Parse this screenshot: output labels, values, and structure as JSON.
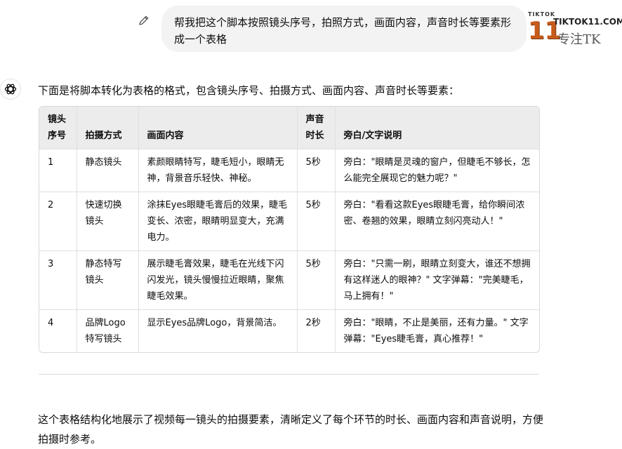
{
  "user_message": {
    "text": "帮我把这个脚本按照镜头序号，拍照方式，画面内容，声音时长等要素形成一个表格"
  },
  "watermark": {
    "top": "TIKTOK",
    "number": "11",
    "site": "TIKTOK11.COM",
    "slogan": "专注TK"
  },
  "assistant": {
    "intro": "下面是将脚本转化为表格的格式，包含镜头序号、拍摄方式、画面内容、声音时长等要素：",
    "table": {
      "headers": [
        "镜头序号",
        "拍摄方式",
        "画面内容",
        "声音时长",
        "旁白/文字说明"
      ],
      "rows": [
        [
          "1",
          "静态镜头",
          "素颜眼睛特写，睫毛短小，眼睛无神，背景音乐轻快、神秘。",
          "5秒",
          "旁白：\"眼睛是灵魂的窗户，但睫毛不够长，怎么能完全展现它的魅力呢？\""
        ],
        [
          "2",
          "快速切换镜头",
          "涂抹Eyes眼睫毛膏后的效果，睫毛变长、浓密，眼睛明显变大，充满电力。",
          "5秒",
          "旁白：\"看看这款Eyes眼睫毛膏，给你瞬间浓密、卷翘的效果，眼睛立刻闪亮动人！\""
        ],
        [
          "3",
          "静态特写镜头",
          "展示睫毛膏效果，睫毛在光线下闪闪发光，镜头慢慢拉近眼睛，聚焦睫毛效果。",
          "5秒",
          "旁白：\"只需一刷，眼睛立刻变大，谁还不想拥有这样迷人的眼神？\" 文字弹幕：\"完美睫毛，马上拥有！\""
        ],
        [
          "4",
          "品牌Logo特写镜头",
          "显示Eyes品牌Logo，背景简洁。",
          "2秒",
          "旁白：\"眼睛，不止是美丽，还有力量。\" 文字弹幕：\"Eyes睫毛膏，真心推荐！\""
        ]
      ]
    },
    "summary": "这个表格结构化地展示了视频每一镜头的拍摄要素，清晰定义了每个环节的时长、画面内容和声音说明，方便拍摄时参考。"
  }
}
